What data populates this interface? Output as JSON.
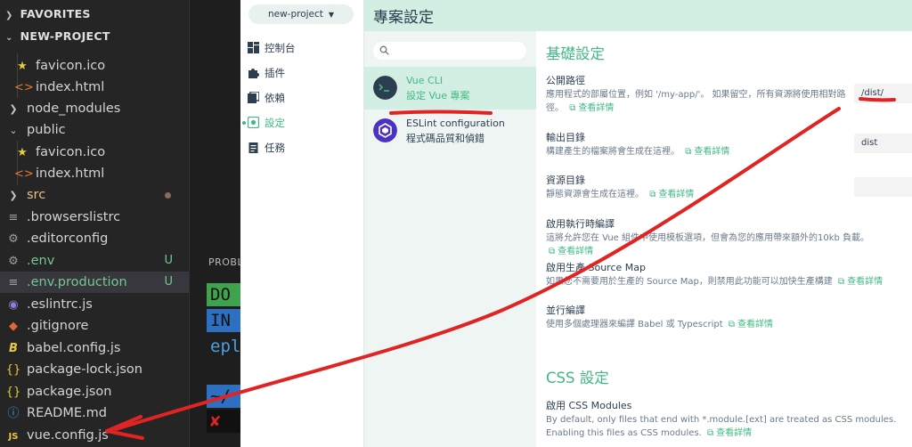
{
  "explorer": {
    "sections": [
      "FAVORITES",
      "NEW-PROJECT"
    ],
    "files": [
      {
        "name": "favicon.ico",
        "icon": "star-icon",
        "badge": ""
      },
      {
        "name": "index.html",
        "icon": "html-icon",
        "badge": ""
      },
      {
        "name": "node_modules",
        "icon": "chevron-right-icon",
        "badge": ""
      },
      {
        "name": "public",
        "icon": "chevron-down-icon",
        "badge": ""
      },
      {
        "name": "favicon.ico",
        "icon": "star-icon",
        "badge": ""
      },
      {
        "name": "index.html",
        "icon": "html-icon",
        "badge": ""
      },
      {
        "name": "src",
        "icon": "chevron-right-icon",
        "badge": ""
      },
      {
        "name": ".browserslistrc",
        "icon": "lines-icon",
        "badge": ""
      },
      {
        "name": ".editorconfig",
        "icon": "gear-icon",
        "badge": ""
      },
      {
        "name": ".env",
        "icon": "gear-icon",
        "badge": "U"
      },
      {
        "name": ".env.production",
        "icon": "lines-icon",
        "badge": "U"
      },
      {
        "name": ".eslintrc.js",
        "icon": "eslint-icon",
        "badge": ""
      },
      {
        "name": ".gitignore",
        "icon": "git-icon",
        "badge": ""
      },
      {
        "name": "babel.config.js",
        "icon": "babel-icon",
        "badge": ""
      },
      {
        "name": "package-lock.json",
        "icon": "braces-icon",
        "badge": ""
      },
      {
        "name": "package.json",
        "icon": "braces-icon",
        "badge": ""
      },
      {
        "name": "README.md",
        "icon": "info-icon",
        "badge": ""
      },
      {
        "name": "vue.config.js",
        "icon": "js-icon",
        "badge": ""
      }
    ]
  },
  "panel": {
    "problems_label": "PROBL",
    "terminal_lines": [
      "DO",
      "IN",
      "epl",
      "~/",
      "✘"
    ]
  },
  "vue_ui": {
    "project_selector": "new-project",
    "nav": [
      "控制台",
      "插件",
      "依賴",
      "設定",
      "任務"
    ],
    "header_title": "專案設定",
    "search_placeholder": "",
    "plugins": [
      {
        "name": "Vue CLI",
        "desc": "設定 Vue 專案"
      },
      {
        "name": "ESLint configuration",
        "desc": "程式碼品質和偵錯"
      }
    ],
    "groups": [
      "基礎設定",
      "CSS 設定"
    ],
    "more_label": "查看詳情",
    "settings": [
      {
        "label": "公開路徑",
        "desc": "應用程式的部屬位置，例如 '/my-app/'。 如果留空，所有資源將使用相對路徑。",
        "value": "/dist/"
      },
      {
        "label": "輸出目錄",
        "desc": "構建產生的檔案將會生成在這裡。",
        "value": "dist"
      },
      {
        "label": "資源目錄",
        "desc": "靜態資源會生成在這裡。",
        "value": ""
      },
      {
        "label": "啟用執行時編譯",
        "desc": "這將允許您在 Vue 組件中使用模板選項，但會為您的應用帶來額外的10kb 負載。",
        "value": ""
      },
      {
        "label": "啟用生產 Source Map",
        "desc": "如果您不需要用於生產的 Source Map，則禁用此功能可以加快生產構建",
        "value": ""
      },
      {
        "label": "並行編譯",
        "desc": "使用多個處理器來編譯 Babel 或 Typescript",
        "value": ""
      },
      {
        "label": "啟用 CSS Modules",
        "desc": "By default, only files that end with *.module.[ext] are treated as CSS modules. Enabling this files as CSS modules.",
        "value": ""
      }
    ]
  },
  "colors": {
    "accent": "#42b983",
    "annotation": "#e02424",
    "header_bg": "#d3eee2"
  }
}
